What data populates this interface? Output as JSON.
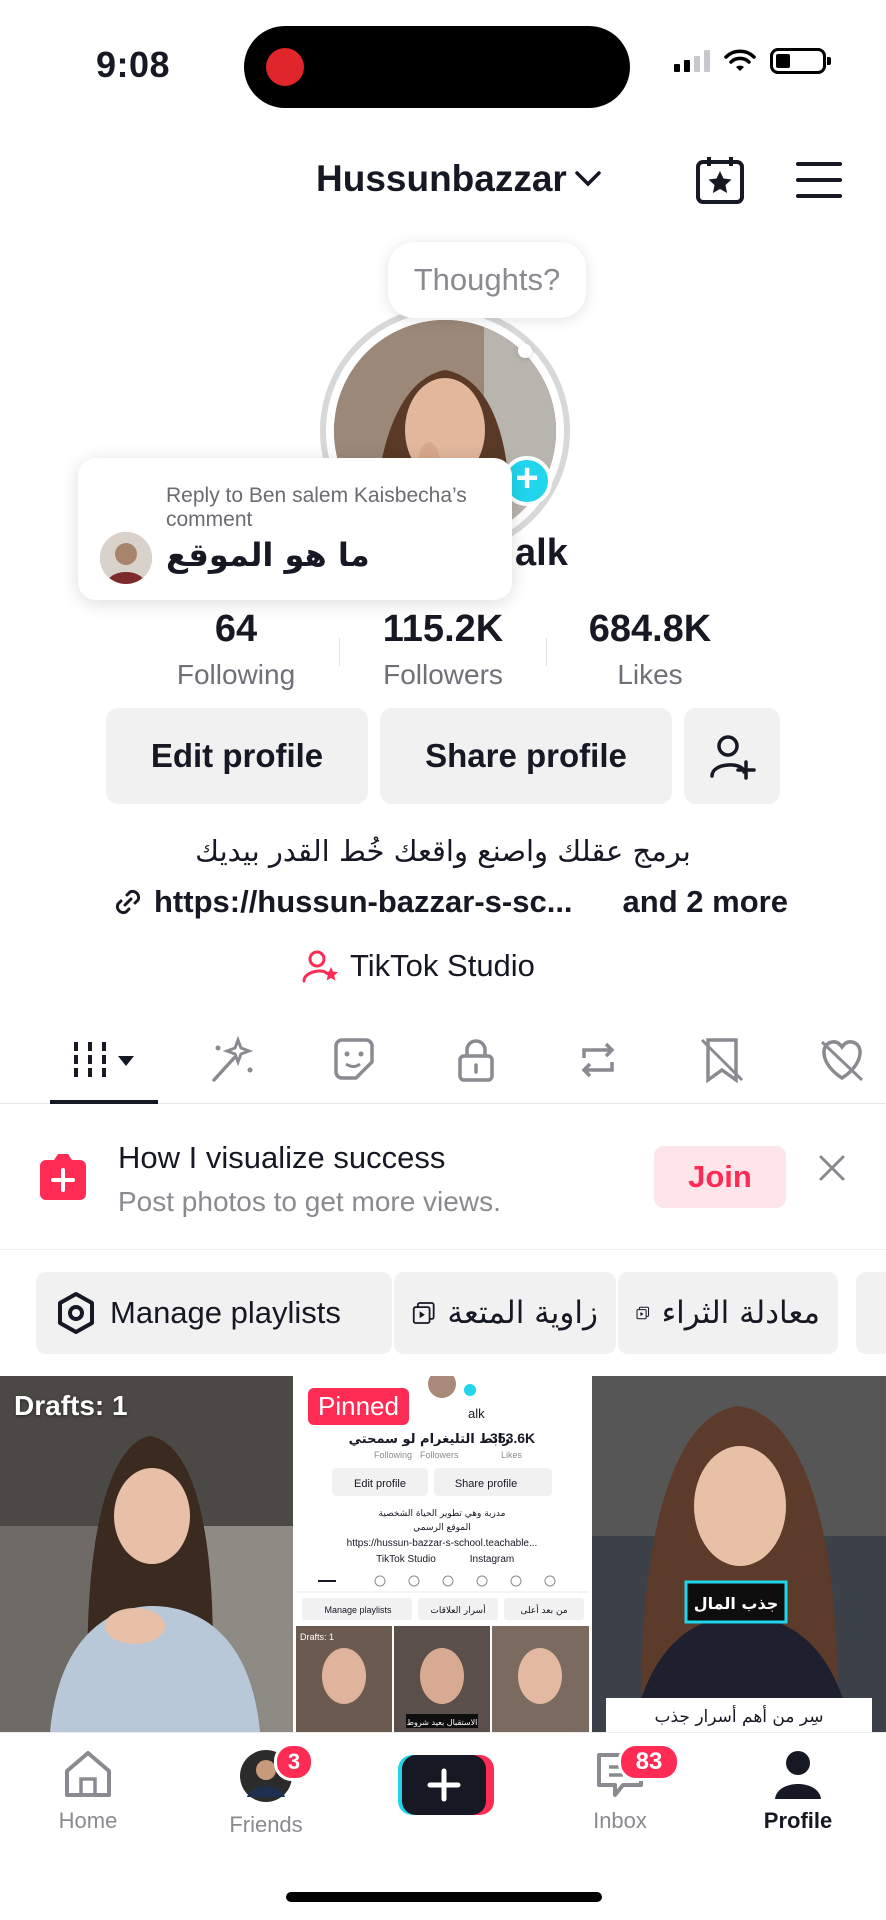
{
  "status_bar": {
    "time": "9:08"
  },
  "header": {
    "username": "Hussunbazzar"
  },
  "avatar": {
    "thought_bubble": "Thoughts?"
  },
  "reply_card": {
    "label": "Reply to Ben salem Kaisbecha’s comment",
    "text": "ما هو الموقع"
  },
  "username_partial": "alk",
  "stats": [
    {
      "value": "64",
      "label": "Following"
    },
    {
      "value": "115.2K",
      "label": "Followers"
    },
    {
      "value": "684.8K",
      "label": "Likes"
    }
  ],
  "buttons": {
    "edit_profile": "Edit profile",
    "share_profile": "Share profile"
  },
  "bio": {
    "text": "برمج عقلك واصنع واقعك خُط القدر بيديك",
    "link": "https://hussun-bazzar-s-sc...",
    "more": "and 2 more"
  },
  "studio": {
    "label": "TikTok Studio"
  },
  "tabs": [
    "videos-grid-icon",
    "sparkle-icon",
    "sticker-icon",
    "lock-icon",
    "repost-icon",
    "favorites-icon",
    "liked-icon"
  ],
  "promo": {
    "title": "How I visualize success",
    "subtitle": "Post photos to get more views.",
    "join": "Join"
  },
  "playlists": [
    {
      "label": "Manage playlists",
      "icon": "gear-icon"
    },
    {
      "label": "زاوية المتعة",
      "icon": "playlist-icon"
    },
    {
      "label": "معادلة الثراء",
      "icon": "playlist-icon"
    }
  ],
  "grid": {
    "drafts": "Drafts: 1",
    "pinned": "Pinned",
    "thumb2": {
      "top_text": "رابط التليغرام لو سمحتي",
      "count": "353.6K",
      "user": "alk",
      "following": "Following",
      "followers": "Followers",
      "likes": "Likes",
      "edit": "Edit profile",
      "share": "Share profile",
      "bio1": "مدربة وهي تطوير الحياة الشخصية",
      "bio2": "الموقع الرسمي",
      "link": "https://hussun-bazzar-s-school.teachable...",
      "studio": "TikTok Studio",
      "instagram": "Instagram",
      "manage": "Manage playlists",
      "pl1": "أسرار العلاقات",
      "pl2": "من بعد أعلى",
      "drafts": "Drafts: 1",
      "caption": "الاستقبال بعيد شروط"
    },
    "thumb3": {
      "tag": "جذب المال",
      "caption": "سِر من أهم أسرار جذب"
    }
  },
  "nav": {
    "home": "Home",
    "friends": "Friends",
    "friends_badge": "3",
    "inbox": "Inbox",
    "inbox_badge": "83",
    "profile": "Profile"
  },
  "colors": {
    "accent": "#fe2c55",
    "cyan": "#20d5ec",
    "text": "#161823",
    "muted": "#8a8b91"
  }
}
